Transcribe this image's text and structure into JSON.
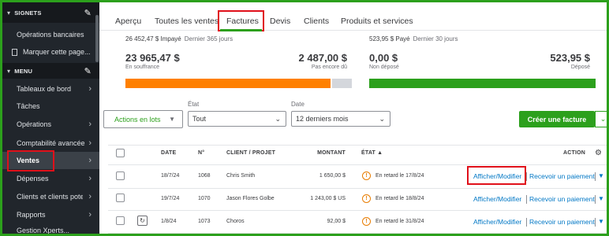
{
  "sidebar": {
    "signets_header": "SIGNETS",
    "items_top": [
      {
        "label": "Opérations bancaires"
      },
      {
        "label": "Marquer cette page..."
      }
    ],
    "menu_header": "MENU",
    "items": [
      {
        "label": "Tableaux de bord"
      },
      {
        "label": "Tâches"
      },
      {
        "label": "Opérations"
      },
      {
        "label": "Comptabilité avancée"
      },
      {
        "label": "Ventes"
      },
      {
        "label": "Dépenses"
      },
      {
        "label": "Clients et clients poten"
      },
      {
        "label": "Rapports"
      }
    ],
    "cut_label": "Gestion Xperts..."
  },
  "tabs": [
    {
      "label": "Aperçu"
    },
    {
      "label": "Toutes les ventes"
    },
    {
      "label": "Factures"
    },
    {
      "label": "Devis"
    },
    {
      "label": "Clients"
    },
    {
      "label": "Produits et services"
    }
  ],
  "summary": {
    "unpaid": {
      "top_amount": "26 452,47 $ Impayé",
      "top_period": "Dernier 365 jours",
      "overdue_amount": "23 965,47 $",
      "overdue_label": "En souffrance",
      "notdue_amount": "2 487,00 $",
      "notdue_label": "Pas encore dû",
      "overdue_fraction": 0.906
    },
    "paid": {
      "top_amount": "523,95 $ Payé",
      "top_period": "Dernier 30 jours",
      "undeposited_amount": "0,00 $",
      "undeposited_label": "Non déposé",
      "deposited_amount": "523,95 $",
      "deposited_label": "Déposé",
      "deposited_fraction": 1.0
    }
  },
  "filters": {
    "batch_actions": "Actions en lots",
    "status_label": "État",
    "status_value": "Tout",
    "date_label": "Date",
    "date_value": "12 derniers mois",
    "create_invoice": "Créer une facture"
  },
  "table": {
    "headers": {
      "date": "DATE",
      "number": "N°",
      "customer": "CLIENT / PROJET",
      "amount": "MONTANT",
      "status": "ÉTAT ▲",
      "action": "ACTION"
    },
    "rows": [
      {
        "date": "18/7/24",
        "number": "1068",
        "customer": "Chris Smith",
        "amount": "1 650,00 $",
        "status": "En retard le 17/8/24",
        "action": "Afficher/Modifier",
        "secondary": "Recevoir un paiement"
      },
      {
        "date": "19/7/24",
        "number": "1070",
        "customer": "Jason Flores Golbe",
        "amount": "1 243,00 $ US",
        "status": "En retard le 18/8/24",
        "action": "Afficher/Modifier",
        "secondary": "Recevoir un paiement"
      },
      {
        "date": "1/8/24",
        "number": "1073",
        "customer": "Choros",
        "amount": "92,00 $",
        "status": "En retard le 31/8/24",
        "action": "Afficher/Modifier",
        "secondary": "Recevoir un paiement"
      }
    ]
  },
  "colors": {
    "accent_green": "#2ca01c",
    "overdue_orange": "#ff8000",
    "notdue_gray": "#d4d7dc",
    "highlight_red": "#e0101a",
    "link_blue": "#0077c5",
    "sidebar_bg": "#21262c"
  },
  "icons": [
    "chevron-down-icon",
    "pencil-icon",
    "bookmark-icon",
    "chevron-right-icon",
    "warning-icon",
    "recurring-icon",
    "gear-icon",
    "sort-up-icon"
  ]
}
